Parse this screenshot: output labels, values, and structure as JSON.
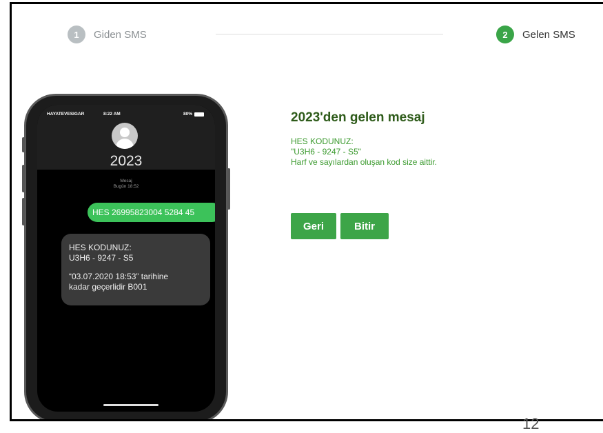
{
  "stepper": {
    "step1": {
      "number": "1",
      "label": "Giden SMS"
    },
    "step2": {
      "number": "2",
      "label": "Gelen SMS"
    }
  },
  "phone": {
    "status": {
      "carrier": "HAYATEVESIGAR",
      "time": "8:22 AM",
      "battery": "80%"
    },
    "contact": "2023",
    "meta_title": "Mesaj",
    "meta_time": "Bugün 18:52",
    "outgoing_message": "HES 26995823004 5284 45",
    "incoming_message": {
      "line1": "HES KODUNUZ:",
      "line2": "U3H6 - 9247 - S5",
      "line3": "“03.07.2020 18:53” tarihine",
      "line4": "kadar geçerlidir B001"
    }
  },
  "panel": {
    "title": "2023'den gelen mesaj",
    "message_lines": [
      "HES KODUNUZ:",
      "\"U3H6 - 9247 - S5\"",
      "Harf ve sayılardan oluşan kod size aittir."
    ],
    "back_button": "Geri",
    "done_button": "Bitir"
  },
  "page_number": "12",
  "colors": {
    "accent": "#3da548",
    "title": "#2e5b1a",
    "inactive_step": "#b9bfc2"
  }
}
